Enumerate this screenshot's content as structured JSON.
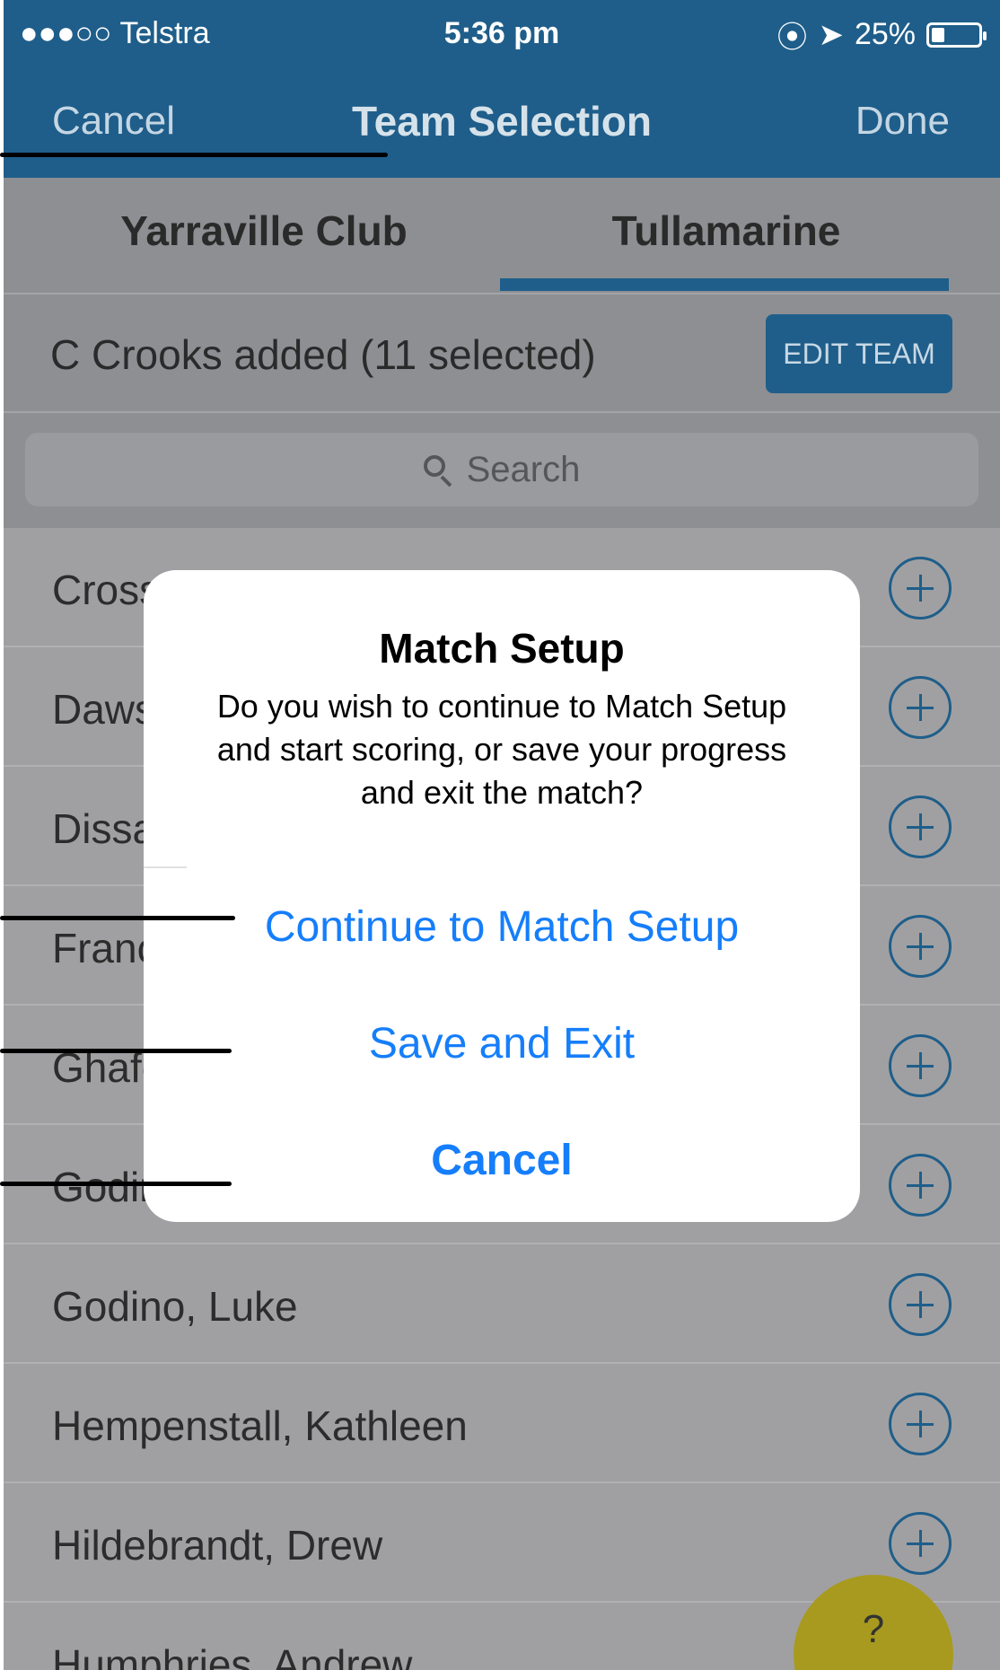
{
  "status_bar": {
    "carrier": "●●●○○ Telstra",
    "time": "5:36 pm",
    "battery": "25%"
  },
  "nav": {
    "cancel": "Cancel",
    "title": "Team Selection",
    "done": "Done"
  },
  "tabs": {
    "items": [
      "Yarraville Club",
      "Tullamarine"
    ],
    "selected": "Tullamarine"
  },
  "selection": {
    "status": "C Crooks added (11 selected)",
    "edit_button": "EDIT TEAM"
  },
  "search": {
    "placeholder": "Search"
  },
  "players": [
    "Cross,",
    "Dawsc",
    "Dissar",
    "Franci",
    "Ghafo",
    "Godin",
    "Godino, Luke",
    "Hempenstall, Kathleen",
    "Hildebrandt, Drew",
    "Humphries, Andrew"
  ],
  "alert": {
    "title": "Match Setup",
    "message": "Do you wish to continue to Match Setup and start scoring, or save your progress and exit the match?",
    "buttons": {
      "continue": "Continue to Match Setup",
      "save_exit": "Save and Exit",
      "cancel": "Cancel"
    }
  },
  "help_button": "?",
  "colors": {
    "nav_blue": "#1f5e8a",
    "ios_blue": "#157efb",
    "help_yellow": "#a89a1e"
  }
}
